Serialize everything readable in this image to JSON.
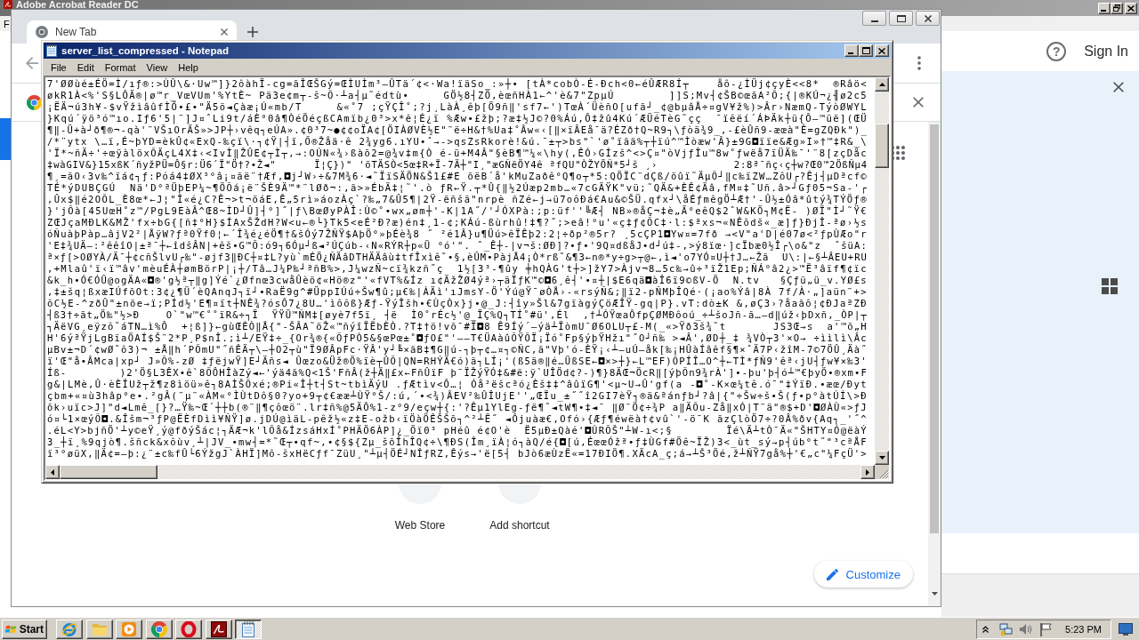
{
  "acrobat": {
    "title": "Adobe Acrobat Reader DC",
    "menu": [
      "F"
    ],
    "help": "?",
    "sign_in": "Sign In"
  },
  "chrome": {
    "tabs": [
      {
        "label": "New Tab",
        "selected": true
      }
    ],
    "shortcuts": [
      {
        "label": "Web Store"
      },
      {
        "label": "Add shortcut"
      }
    ],
    "customize": "Customize"
  },
  "notepad": {
    "title": "server_list_compressed - Notepad",
    "menu": [
      "File",
      "Edit",
      "Format",
      "View",
      "Help"
    ],
    "lines": [
      "7'ØØùé±ÉÖ=Ì/ıƒ®:>ÙÛ\\&·Uw™]}2ôàhÏ-cg=ãÎŒŠGý=ŒÌUÌm³—ÛTä´¢<·Wa!ïäSo_:»┼• [tÀ*cobÒ-É-Ðch<0←éÛÆR8Í┬    åô-¿ÌÜj¢çyÈ<<8*  ®Râö<",
      "økR1À<%'S§LÔÄ®|ø™r_VœVUm'%YtÈ~ Pä3e¢m┬-š~Õ·┴a┤µ˜édtù•     GÖ½8┤ZÖ,èœñHÀ1←^'è&7\"ZpµÚ        ]]S;Mv┤¢ŠB©œãA²Õ;{|®KÚ¬¿╢ø2c5",
      "¡ËÄ¬ú3h¥-$vŸžìâûfÌÖ•£•\"Ä5ö◄Çàæ¡Ú«mb/T     &«˚7 ;çŸÇÎ˚;?j¸LàÀ¸êþ[Ö9ñ‖'sf7←')TœÀ´ÜèñO[ufã┘_¢@bµâÅ÷¤gV¥ž%)>Âr›NæmQ-TýòØWYL",
      "}Kqú´ÿö³ó™ıo.Iƒ6'5|¨]J¤ˆLi9t/áÈ°0â¶ÒéÖéçßCAmïb¿0³>x*ê¦É¿ï %Æw•£žþ;?æ‡½J©?0%Áú,Ô‡žû4Kú´ÆÜéTèG˜çç  ¯ïêëí´ÁÞÄk┼ü{Ô—™üë](ŒÜ",
      "¶‖-Ü+à┘ð¶®¬-qà'¨VŠıOrÄŠ»>JP┼›vêq┐eÚA».¢0³7~●¢¢oÏA¢[ÖIÀØVÈ½E\"¨ë÷H&†%Ua‡˚Âw«‹[‖×ïÂEå¯ä?ÉZð†Q~R9┐\\ƒòä¾9_,-£èÛñ9-æœà\"Ê=gZQÐk\")_",
      "/*¨ytx \\…ï,É~þYD=èkÛ¢«ExQ-‰çï\\·┐¢Ÿ|┤ï,Ő®Žåä·ê 2¾yg6.ıYU•ˆ→->qsZsRkorè!&ú.¯±┬>bs\"`'ø˚ïãä%┬┼ïú^™Ìòæw'Â}±9G◘ïïe&Æg»I»†™‡R&_\\",
      "'Ï*~ñÄ÷'÷œÿàlöxÕÄçL4X‡‹<IvÌ‖ŽÛE¢┬Ì┬,→:OÚN«¾›ßàõ2=@¾v‡m{Ò é-ü+M4Â\"§èB¶™¼«\\hy(,ÊÓ›GÍzš^<>Ç¤\"òVjƒÎu™8w˚ƒwëå7ïÜÄ‰¯'¨8[zçDåc",
      "‡wàGIV&}15xßK´ñyžPÜ=Ô§r:Ü6´Ï\"Ö†?•Ž◄\"      Ï¦Ç})\" 'öTÄSÒ<5œ‡R+Ï-7Ä┼\"I¸\"æGÑëÖY4ê ªfQU\"ÒŽYÖÑ*5┘š ¸›            2:8ª¯ñç‹ç┼w?Œ0™2ÖßÑµ4",
      "¶¸=ãO‹3v‰^ïá¢┐ƒ:Póá4‡ØX³°â¡¤ãë¨†Æf,◘j┘W›÷&7M¾6·◄˜ÏïSÄÖN&Š1£#E õëB´å'kMuZaðê°Q¶o┬*5:QÖÏC¨dÇß/öûï˜ÄµÕ┘‖c‰ïZW…ZôU┌?Êj┤µDªcf©",
      "TÉ*ýDUBÇGÚ  Nä'D°ªÜþEP¼~¶ÖÕá¡ë¨ŠÈ9Ä™*¨lØð¬:,ã>»ÉbÄ‡¦˜'.ò ƒR←Ÿ.┬*Û{‖½2Úæp2mb…«7cGÄŸK\"vü;˜QÄ&+ÈÊ¢Äâ,fM¤‡˜Uñ.â>┘Gƒ05¬Sa-'┌",
      ",Ûx$‖é2OÕL_È8œ*←J¦\"Î«é¿C?Ê¬>t¬öáE,Ê„5rì»áozÀç`?‰„7&Û5¶|2Ÿ-ëñšã\"nrpè ñZé←j→ü7oôÐá€Au&©ŠÜ.qfx┘\\åÉƒmêgÖ┴Æ†'-Û½±Óâ*ûtý¾TÝÖƒ®",
      "}'jÕà[45UœH˚z™/PgL9EàÂ^Œ8~ÌD┘Û]┤°]˝|ƒ\\BœØyPÀÎ:Ù©˚•wx„øm┼'-K|1A˝/'┘ÓXPà:;p:üf''╚Æ┤ NB»®åÇ¬‡è„Ä°eêQ$2ˆW&KÖ┐M¢Ë- )ØÏ\"Ì┘˜Ÿ€",
      "ZŒJçaMÐLK&MŽ'fx÷bG{[ñ‡°H}$ÍAxŠŽdH?W<u←®└}Tk5<eÉ²Ð?æ)én‡¸1-¢;KÁú-ßùrhû!‡¶?˝;>eâ!°u'«ç‡ƒ¢ÕC‡·l:$ªxs¬«NÊôdš«_æ]ƒ}ÐjÎ-ªø›½s",
      "óÑuàþPàp…âjV2²|ÅÿW?ƒª0Ÿf0¦←´Î¾é¿éÖ¶†&šÓý7ŽÑŸ$AþÖ°»þÉè¾8 ˝ ²é1Â}u¶Üú>êÏÊþ2:2¦÷ðp²®5r? ¸5cÇP1◘Yw¤=7fð →<V\"a'D|é07ø<²ƒpÙÆo\"r",
      "'E‡¾UÄ—:²êêîO|±ª¯┼←îdšÂN|+êš•G™Õ:ó9┐6Óµ┘ß◄²ÚÇúb-‹N«RÝR┼p«Ü °ó'\". ˆ_Ê┼-|v¬š:ØÐ]?•ƒ•'9Q¤dßåJ•d┘ú‡-,>ý8ïœ·]cÏbæ0½Î┌\\o&\"z  ˆšüA:",
      "ª×ƒ[>OØYÀ/Ä¯┼¢cñŠlvU┌‰\"-øjf3‖ÐC┼¤‡L?yù`mÉÖ¿ÑÄâDTHÄÄâù‡tfÎxìê˜•§,èÛM•PàjÅ4¡Ò*rß˜&¶3←n®*y÷g>┬@←,ì◄'o7YÓ¤U┼†J…←Žã  U\\:|←§┴ÂEU+RU",
      ",+Mlaû'ï‹ï™âv'mèuÉÀ┼ømBörP|¡┼/Tâ…J¼P‰┘ªñB%>,J¼wzÑ~cï¾kzñ˝ç  1½[3³-¶ûy ╪hQÀG't┼>]žY7>Àjv¬8…5c‰→û÷³ïŽ1Ep;ÑÁ°â2¿>™Ë³âïf¶¢ïc",
      "&k_h•Ó€ÓÛ@ogÄA«◘®'g½ª┬‖g]Ýé`¿Øfnœ3cwåÛèö¢«Hö®z\"'«fVT%&Íz ı¢ÄžŽØ4ýª›┬äÏƒK™©◘6¸ê┤'•¤┼|$E6qä◘àÎ6ï9©ßV-Ö  N.tv   §Çƒü„ü_v.YØ£s",
      ",‡±šq¦ßxæIÚfõOt:3¢¿¶Ü´èQAnqJ┐ï┘•RaË9g^#ÜppIÚú÷Šw¶û;µ€‰|ÀÄì'ıJmsY-Ö'Ýú@Ÿ¯øÒÅ›-«rsýÑ&;‖ï2-pÑMþÎQé·(¡ao%Ýâ|8À 7f/À·„]aün¨+>",
      "ôC½E-^zðÛ\"±nõe→ï;PÍd½'E¶¤ït┼NÊ¾?ósÔ7¿8U…'ìôôß}Æƒ-ŸýÎšh•€ÙçÒx}j•@_J:┤îy»Šl&7gïàgýÇöÆÎŸ-gq|P}.vT:dò±K &,øÇ3›?åaãô¦¢ÐJaªZÐ",
      "┤ß3†÷ãt„Ö‰\"½>Ð    O`\"w™€˚˚ïR&÷┐Ï  ŸŸÜ™ÑM‡[øyè7f5ï¸ ┤ë  Ì0˚rÉc½'@_ÏÇ%Q┐TÍ˚#ü',Él  ,†┴ÓŸœaÔfpÇØMÐôoú_÷┴šoJñ-ã…—d‖úž‹þDxñ,_ÒP|┬",
      "┐ÄëVG¸eÿzô˜áTN…ì%Ô  +¦ß]}←gùŒÈÒ‖Å{\"-ŠÂA˜öŽ«™ñýîÏËbÈÒ.?T‡†ö!võ¯#Ï◘8 Ê9Íý´—ýä┴ÏòmU¯Ø6OLU┬£-M(_«>Ÿð3š¾˜t       JS3Œ→s  a'™õ„H",
      "H'6ýªŸjLgBïaÖAÍ$Š¨2*P¸P$nÎ.;ì┴/EŸ‡÷_{Or¾®{«ÕƒPÒ5&§œPœ±˚◘ƒO£\"'——T€ÜAàûÕŸÕÏ¡Ïó˚Fp§ýþŸHžı\"˝O┘ñ‰ >◄Â',ØD┼_‡ ¾VÒ┬3'×O→ ÷ììlì\\Âc",
      "µBv±¬D´¢wØ˜ô3)¬ ±Å‖h´PÕmU\"˝ñÊÄ┬\\—┼O2┬ù\"Ï9ØÂpFc·ŸÂ'y┘╚×ãB‡¶G‖ú-┐þ┬¢…¤┐©ÑC,ã\"Vþ'ó-ÈŸ¡‹┴—uÚ—åk[‰¡HÛàÍâêf§¶×ˆÄ7P‹žîM-7©7ÖÛ¸Äà˝",
      "ï'Œ\"å•ÂMca|xp┘ J»Õ%-zØ ‡ƒëjwŸ]E┘Äñs◄ Ûœzo&Üž®Ö%ïè┬ÛÕ|QN=RHÝÄ€ó)ã┐LÍ¡'(ß5ä®‖é…ÜßSE←◘×>┼}←L™EF)ÕPÍÎ…O^┼←TÌ*ƒÑ9'êª‹jU┤ƒw¥×‰3'",
      "Íß-        )2'Ö§L3ÊX•ê`8ÕÔHÎàZý◄←'ýä4ã%Q<1Š'FñÂ(ž┼Ä‖£x←FñÛïF þ¯ÏŽýŸÓ‡&#ë:ÿ`UÎÖd¢?-)¶}8ÄŒ¬ÖcR‖[ýþÕn9¾rÀ']•-þu'þ┤ó┴™€þyÖ•®xm•F",
      "g&|LMè,Û·èÈÎUž┬ž¶z8ìöü»ê┐8AÌŠÕxé;®Pi«Î┼t┤St~tbìÄýU .ƒÆtìv<Ô…¦ Óå²ëšcªó¿Èš‡‡^âûïG¶'<µ~U→Û'gf(a -◘˚-K×œ¼tê.ó¯\"‡ÝïÐ.•æœ/Ðyt",
      "çbm+«¤ù3hâp°e•.²gÂ(¨µ¨«ÀM«°ÌÙtDô§0?yo+9┬¢€ææ┴ÙŸ°Š/:ú,´•<¾)ÂEV²‰ÛÎUjE''„ŒÏu_±˝˝î2GI7èŸ┐®ä&ªánƒb┘?â|{\"÷Šw÷š•Š(ƒ•p°àtÚÍ\\>Ð",
      "õk›uïc>J]\"d◄Lmê_[}?…Ÿ‰~Œ´┼┼b(®¨‖¶çôœö¨.lr‡ñ%@5ÄÔ%1-z°9/eçw┼{:'?Êµ1YlEg-ƒë¶˜◄tW¶•‡◄¯ ‖Ø¨Ö¢÷¾P a‖ÄÕu-Zå‖xÓ|T¨ä\"®$+D'◘ØÀÙ«>ƒJ",
      "ó¤└1×œýÕ◘.&Îšm¬³ƒP@ËÈfDìì¥ÑŸ]ø.jDÚ@ìäL-pêž½«z‡E-ožb‹ïÖàÖÊŠŠõ┐^²┴Ë˝ ◄Ôjuàæ€,Ofó›{Æƒ¶éwëà†¢vû`'-ö¯K ãzÇlòÖ7÷?0Â%ðv{Aq┐_'˝^",
      ".éL<Y>bjñÖ'┴y©eŸ¸ý@fðýŠác¦┐ÄÆ¬k'lÕå&ÍzsáHxÍ˚PHÄÖ6ÀP]¿_Öï0³ pHéû é¢O'è  Ë5µÐ±Qàé'◘ÚRÕŠ\"┴W-ı<;§        Ïé\\Ä┴tÒ¯Ä«\"ŠHTY¤Ó@ëàÝ",
      "3_┼ï¸%9qjò¶.šñck&xôùv¸┴|JV_•mw┤=*˜Œ┬•qf~,•¢§${Zµ_šõÎhÎQ¢÷\\¶ÐS(Îm¸ïÀ¦ó┐àQ/é{◘[ú,ÉœœÓžª•ƒ‡ÙGf#Öê~ÏŽ)3<_ùt_sý→p┤úb°t˝\"³cªÅF",
      "ï³°øüX,‖Ä¢=—þ:¿¨±c‰fÛ└6ÝžgJ`ÀHÏ]Mô-šxHëCƒf¯ZüU¸\"┴µ┤ÖÉ┘NÎƒRZ,Êýs→'ë[5┤ bJò6æÙzË«=17ÐIÖ¶.XÄcA_ç;á→┴Š³Öé,ž┴ÑŸ7gå%┼'€„c\"¼FçÜ'>"
    ]
  },
  "taskbar": {
    "start": "Start",
    "apps": [
      {
        "kind": "ie",
        "selected": false
      },
      {
        "kind": "folder",
        "selected": false
      },
      {
        "kind": "player",
        "selected": false
      },
      {
        "kind": "chrome",
        "selected": false
      },
      {
        "kind": "opera",
        "selected": false
      },
      {
        "kind": "acrobat",
        "selected": false
      },
      {
        "kind": "notepad",
        "selected": true
      }
    ],
    "clock": "5:23 PM"
  }
}
